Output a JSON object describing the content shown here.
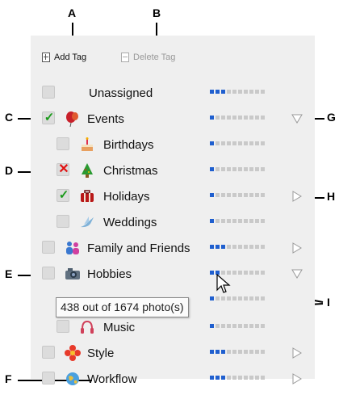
{
  "toolbar": {
    "add_label": "Add Tag",
    "delete_label": "Delete Tag"
  },
  "tags": [
    {
      "label": "Unassigned",
      "check": "none",
      "icon": "none",
      "meter": 3
    },
    {
      "label": "Events",
      "check": "checked",
      "icon": "balloon-icon",
      "meter": 1,
      "triangle": "down"
    },
    {
      "label": "Birthdays",
      "check": "none",
      "icon": "cake-icon",
      "meter": 1
    },
    {
      "label": "Christmas",
      "check": "excluded",
      "icon": "christmas-tree-icon",
      "meter": 1
    },
    {
      "label": "Holidays",
      "check": "checked",
      "icon": "suitcase-icon",
      "meter": 1,
      "triangle": "right"
    },
    {
      "label": "Weddings",
      "check": "none",
      "icon": "dove-icon",
      "meter": 1
    },
    {
      "label": "Family and Friends",
      "check": "none",
      "icon": "people-icon",
      "meter": 3,
      "triangle": "right"
    },
    {
      "label": "Hobbies",
      "check": "none",
      "icon": "camera-icon",
      "meter": 2,
      "triangle": "down"
    },
    {
      "label": "Music",
      "check": "none",
      "icon": "headphones-icon",
      "meter": 1
    },
    {
      "label": "Style",
      "check": "none",
      "icon": "flower-icon",
      "meter": 3,
      "triangle": "right"
    },
    {
      "label": "Workflow",
      "check": "none",
      "icon": "globe-icon",
      "meter": 3,
      "triangle": "right"
    }
  ],
  "meter_total": 10,
  "tooltip": "438 out of 1674 photo(s)",
  "callouts": [
    "A",
    "B",
    "C",
    "D",
    "E",
    "F",
    "G",
    "H",
    "I"
  ],
  "colors": {
    "meter_on": "#1f5fcf",
    "meter_off": "#c9c9c9",
    "check": "#1a9a1a",
    "exclude": "#e01010"
  }
}
